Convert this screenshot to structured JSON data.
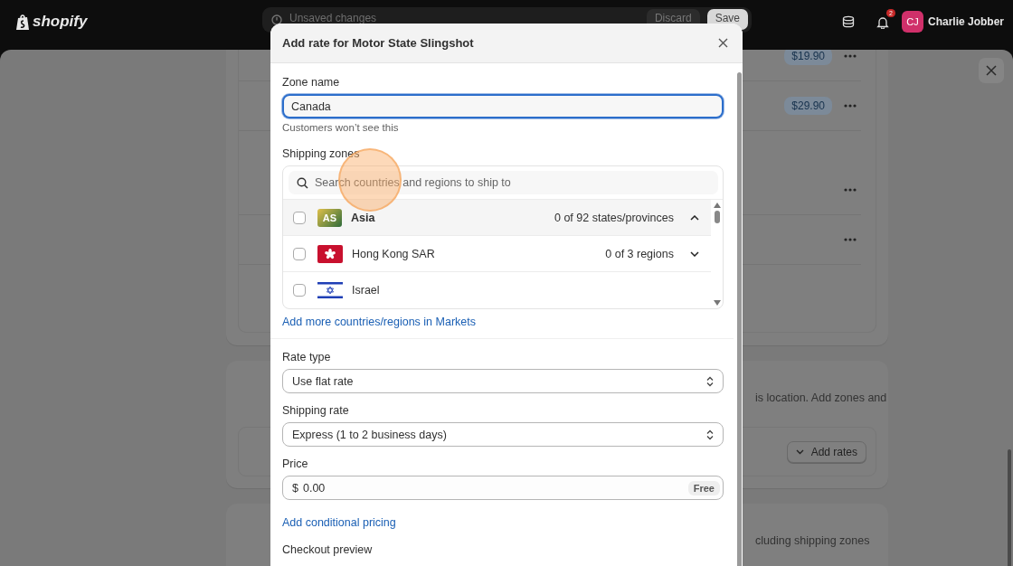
{
  "topbar": {
    "brand": "shopify",
    "unsaved_message": "Unsaved changes",
    "buttons": [
      "Discard",
      "Save"
    ],
    "notification_count": "2",
    "user": {
      "initials": "CJ",
      "name": "Charlie Jobber"
    }
  },
  "background": {
    "rows": [
      {
        "kind": "price",
        "price": "$19.90"
      },
      {
        "kind": "price",
        "price": "$29.90"
      },
      {
        "kind": "menu"
      },
      {
        "kind": "menu"
      }
    ],
    "notice_text": "is location. Add zones and",
    "add_rates_button": "Add rates",
    "footer_text": "cluding shipping zones"
  },
  "modal": {
    "title": "Add rate for Motor State Slingshot",
    "zone_name": {
      "label": "Zone name",
      "value": "Canada",
      "help": "Customers won’t see this"
    },
    "shipping_zones": {
      "label": "Shipping zones",
      "search_placeholder": "Search countries and regions to ship to",
      "regions": [
        {
          "kind": "continent",
          "badge": "AS",
          "name": "Asia",
          "count": "0 of 92 states/provinces",
          "checked": false,
          "expanded": true
        },
        {
          "kind": "hong-kong",
          "name": "Hong Kong SAR",
          "count": "0 of 3 regions",
          "checked": false,
          "expanded": false
        },
        {
          "kind": "israel",
          "name": "Israel",
          "checked": false
        }
      ],
      "link": "Add more countries/regions in Markets"
    },
    "rate_type": {
      "label": "Rate type",
      "value": "Use flat rate"
    },
    "shipping_rate": {
      "label": "Shipping rate",
      "value": "Express (1 to 2 business days)"
    },
    "price": {
      "label": "Price",
      "currency": "$",
      "value": "0.00",
      "badge": "Free"
    },
    "conditional_link": "Add conditional pricing",
    "checkout_preview": "Checkout preview"
  }
}
